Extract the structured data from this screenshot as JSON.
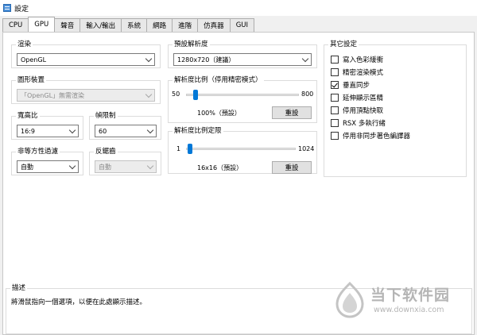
{
  "window": {
    "title": "設定"
  },
  "tabs": [
    "CPU",
    "GPU",
    "聲音",
    "輸入/輸出",
    "系統",
    "網路",
    "進階",
    "仿真器",
    "GUI"
  ],
  "active_tab": "GPU",
  "render": {
    "label": "渲染",
    "value": "OpenGL"
  },
  "device": {
    "label": "圖形裝置",
    "value": "「OpenGL」無需渲染"
  },
  "aspect": {
    "label": "寬高比",
    "value": "16:9"
  },
  "framelimit": {
    "label": "幀限制",
    "value": "60"
  },
  "aniso": {
    "label": "非等方性過濾",
    "value": "自動"
  },
  "antialias": {
    "label": "反鋸齒",
    "value": "自動"
  },
  "resolution": {
    "label": "預設解析度",
    "value": "1280x720（建議）"
  },
  "res_scale": {
    "label": "解析度比例（停用精密模式）",
    "min": "50",
    "max": "800",
    "value_text": "100%（預設）",
    "value": 100,
    "min_val": 50,
    "max_val": 800,
    "reset": "重設"
  },
  "res_limit": {
    "label": "解析度比例定限",
    "min": "1",
    "max": "1024",
    "value_text": "16x16（預設）",
    "value": 16,
    "min_val": 1,
    "max_val": 1024,
    "reset": "重設"
  },
  "other": {
    "label": "其它設定",
    "items": [
      {
        "label": "寫入色彩緩衝",
        "checked": false
      },
      {
        "label": "精密渲染模式",
        "checked": false
      },
      {
        "label": "垂直同步",
        "checked": true
      },
      {
        "label": "延伸顯示區精",
        "checked": false
      },
      {
        "label": "停用頂點快取",
        "checked": false
      },
      {
        "label": "RSX 多執行緒",
        "checked": false
      },
      {
        "label": "停用非同步著色編譯器",
        "checked": false
      }
    ]
  },
  "description": {
    "label": "描述",
    "text": "將滑鼠指向一個選項，以便在此處顯示描述。"
  },
  "watermark": {
    "main": "当下软件园",
    "sub": "www.downxia.com"
  }
}
